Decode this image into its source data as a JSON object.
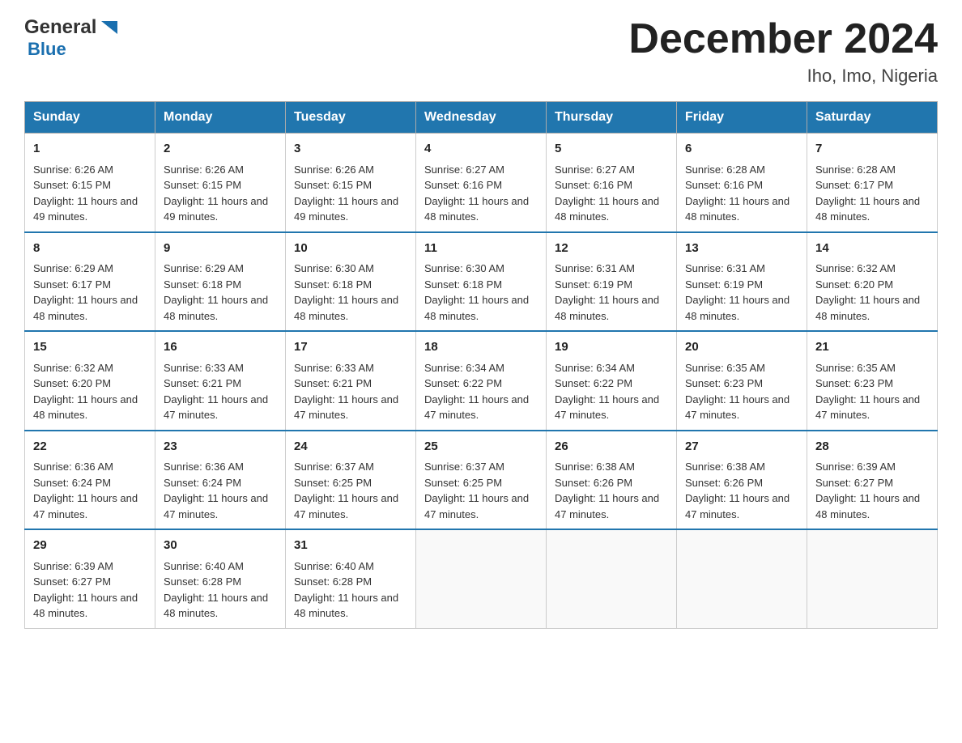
{
  "header": {
    "logo_general": "General",
    "logo_blue": "Blue",
    "month_title": "December 2024",
    "subtitle": "Iho, Imo, Nigeria"
  },
  "calendar": {
    "days": [
      "Sunday",
      "Monday",
      "Tuesday",
      "Wednesday",
      "Thursday",
      "Friday",
      "Saturday"
    ],
    "weeks": [
      [
        {
          "day": "1",
          "sunrise": "6:26 AM",
          "sunset": "6:15 PM",
          "daylight": "11 hours and 49 minutes."
        },
        {
          "day": "2",
          "sunrise": "6:26 AM",
          "sunset": "6:15 PM",
          "daylight": "11 hours and 49 minutes."
        },
        {
          "day": "3",
          "sunrise": "6:26 AM",
          "sunset": "6:15 PM",
          "daylight": "11 hours and 49 minutes."
        },
        {
          "day": "4",
          "sunrise": "6:27 AM",
          "sunset": "6:16 PM",
          "daylight": "11 hours and 48 minutes."
        },
        {
          "day": "5",
          "sunrise": "6:27 AM",
          "sunset": "6:16 PM",
          "daylight": "11 hours and 48 minutes."
        },
        {
          "day": "6",
          "sunrise": "6:28 AM",
          "sunset": "6:16 PM",
          "daylight": "11 hours and 48 minutes."
        },
        {
          "day": "7",
          "sunrise": "6:28 AM",
          "sunset": "6:17 PM",
          "daylight": "11 hours and 48 minutes."
        }
      ],
      [
        {
          "day": "8",
          "sunrise": "6:29 AM",
          "sunset": "6:17 PM",
          "daylight": "11 hours and 48 minutes."
        },
        {
          "day": "9",
          "sunrise": "6:29 AM",
          "sunset": "6:18 PM",
          "daylight": "11 hours and 48 minutes."
        },
        {
          "day": "10",
          "sunrise": "6:30 AM",
          "sunset": "6:18 PM",
          "daylight": "11 hours and 48 minutes."
        },
        {
          "day": "11",
          "sunrise": "6:30 AM",
          "sunset": "6:18 PM",
          "daylight": "11 hours and 48 minutes."
        },
        {
          "day": "12",
          "sunrise": "6:31 AM",
          "sunset": "6:19 PM",
          "daylight": "11 hours and 48 minutes."
        },
        {
          "day": "13",
          "sunrise": "6:31 AM",
          "sunset": "6:19 PM",
          "daylight": "11 hours and 48 minutes."
        },
        {
          "day": "14",
          "sunrise": "6:32 AM",
          "sunset": "6:20 PM",
          "daylight": "11 hours and 48 minutes."
        }
      ],
      [
        {
          "day": "15",
          "sunrise": "6:32 AM",
          "sunset": "6:20 PM",
          "daylight": "11 hours and 48 minutes."
        },
        {
          "day": "16",
          "sunrise": "6:33 AM",
          "sunset": "6:21 PM",
          "daylight": "11 hours and 47 minutes."
        },
        {
          "day": "17",
          "sunrise": "6:33 AM",
          "sunset": "6:21 PM",
          "daylight": "11 hours and 47 minutes."
        },
        {
          "day": "18",
          "sunrise": "6:34 AM",
          "sunset": "6:22 PM",
          "daylight": "11 hours and 47 minutes."
        },
        {
          "day": "19",
          "sunrise": "6:34 AM",
          "sunset": "6:22 PM",
          "daylight": "11 hours and 47 minutes."
        },
        {
          "day": "20",
          "sunrise": "6:35 AM",
          "sunset": "6:23 PM",
          "daylight": "11 hours and 47 minutes."
        },
        {
          "day": "21",
          "sunrise": "6:35 AM",
          "sunset": "6:23 PM",
          "daylight": "11 hours and 47 minutes."
        }
      ],
      [
        {
          "day": "22",
          "sunrise": "6:36 AM",
          "sunset": "6:24 PM",
          "daylight": "11 hours and 47 minutes."
        },
        {
          "day": "23",
          "sunrise": "6:36 AM",
          "sunset": "6:24 PM",
          "daylight": "11 hours and 47 minutes."
        },
        {
          "day": "24",
          "sunrise": "6:37 AM",
          "sunset": "6:25 PM",
          "daylight": "11 hours and 47 minutes."
        },
        {
          "day": "25",
          "sunrise": "6:37 AM",
          "sunset": "6:25 PM",
          "daylight": "11 hours and 47 minutes."
        },
        {
          "day": "26",
          "sunrise": "6:38 AM",
          "sunset": "6:26 PM",
          "daylight": "11 hours and 47 minutes."
        },
        {
          "day": "27",
          "sunrise": "6:38 AM",
          "sunset": "6:26 PM",
          "daylight": "11 hours and 47 minutes."
        },
        {
          "day": "28",
          "sunrise": "6:39 AM",
          "sunset": "6:27 PM",
          "daylight": "11 hours and 48 minutes."
        }
      ],
      [
        {
          "day": "29",
          "sunrise": "6:39 AM",
          "sunset": "6:27 PM",
          "daylight": "11 hours and 48 minutes."
        },
        {
          "day": "30",
          "sunrise": "6:40 AM",
          "sunset": "6:28 PM",
          "daylight": "11 hours and 48 minutes."
        },
        {
          "day": "31",
          "sunrise": "6:40 AM",
          "sunset": "6:28 PM",
          "daylight": "11 hours and 48 minutes."
        },
        null,
        null,
        null,
        null
      ]
    ],
    "sunrise_label": "Sunrise: ",
    "sunset_label": "Sunset: ",
    "daylight_label": "Daylight: "
  }
}
